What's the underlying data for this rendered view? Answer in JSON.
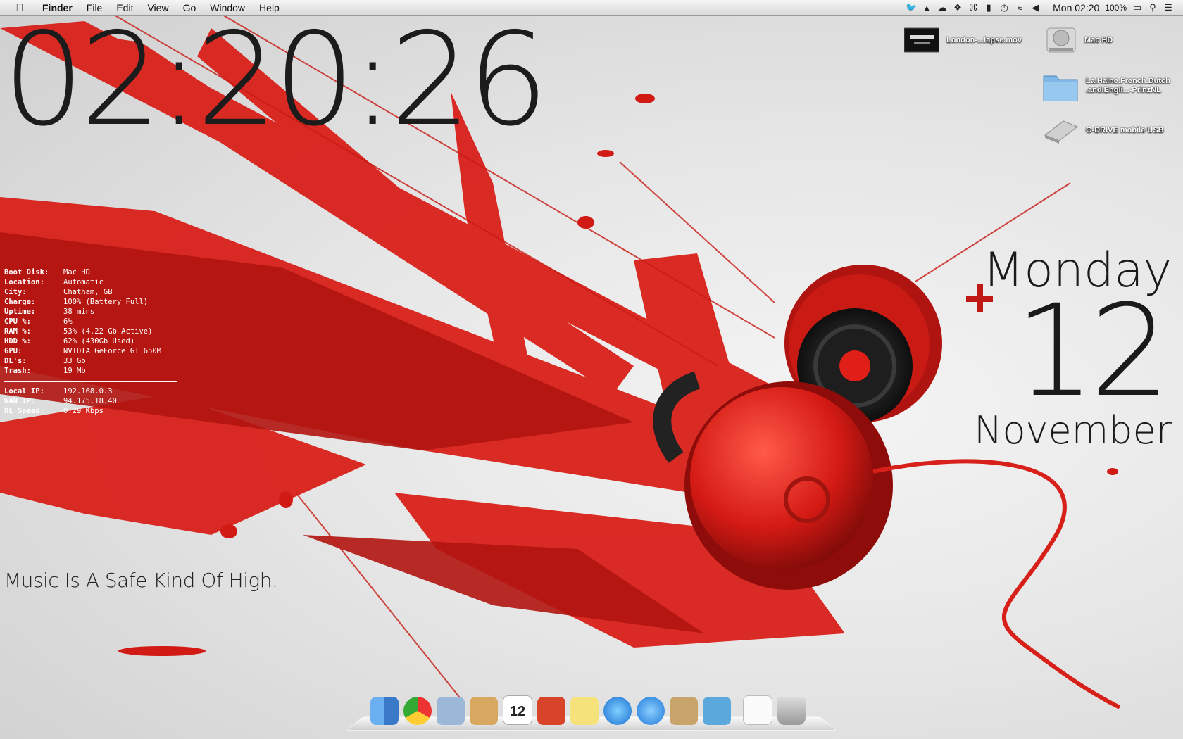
{
  "menubar": {
    "app": "Finder",
    "items": [
      "File",
      "Edit",
      "View",
      "Go",
      "Window",
      "Help"
    ],
    "status_icons": [
      "twitter-icon",
      "google-drive-icon",
      "cloud-icon",
      "dropbox-icon",
      "rss-icon",
      "battery-bars-icon",
      "time-machine-icon",
      "wifi-icon",
      "volume-icon"
    ],
    "clock": "Mon 02:20",
    "battery": "100%"
  },
  "clock_widget": {
    "time": "02:20:26"
  },
  "stats": {
    "rows": [
      {
        "k": "Boot Disk:",
        "v": "Mac HD"
      },
      {
        "k": "Location:",
        "v": "Automatic"
      },
      {
        "k": "City:",
        "v": "Chatham, GB"
      },
      {
        "k": "Charge:",
        "v": "100% (Battery Full)"
      },
      {
        "k": "Uptime:",
        "v": "38 mins"
      },
      {
        "k": "CPU %:",
        "v": "6%"
      },
      {
        "k": "RAM %:",
        "v": "53% (4.22 Gb Active)"
      },
      {
        "k": "HDD %:",
        "v": "62% (430Gb Used)"
      },
      {
        "k": "GPU:",
        "v": "NVIDIA GeForce GT 650M"
      },
      {
        "k": "DL's:",
        "v": "33 Gb"
      },
      {
        "k": "Trash:",
        "v": "19 Mb"
      }
    ],
    "net_rows": [
      {
        "k": "Local IP:",
        "v": "192.168.0.3"
      },
      {
        "k": "WAN IP:",
        "v": "94.175.18.40"
      },
      {
        "k": "DL Speed:",
        "v": "0.29 Kbps"
      }
    ]
  },
  "quote": "Music Is A Safe Kind Of High.",
  "date_widget": {
    "day": "Monday",
    "date": "12",
    "month": "November"
  },
  "desktop": {
    "icons": [
      {
        "name": "movie-file-icon",
        "label": "London-...lapse.mov"
      },
      {
        "name": "hard-drive-icon",
        "label": "Mac HD"
      },
      {
        "name": "folder-icon",
        "label": "La.Haine.French.Dutch .and.Engli...-PrinzNL"
      },
      {
        "name": "external-drive-icon",
        "label": "G-DRIVE mobile USB"
      }
    ]
  },
  "dock": {
    "apps": [
      "finder-icon",
      "chrome-icon",
      "mail-bird-icon",
      "address-book-icon",
      "calendar-icon",
      "wunderlist-icon",
      "stickies-icon",
      "itunes-icon",
      "app-store-icon",
      "recycle-box-icon",
      "twitter-icon",
      "torrent-file-icon",
      "trash-icon"
    ],
    "calendar_date": "12"
  },
  "colors": {
    "accent_red": "#d81e1e",
    "menubar": "#e8e8e8"
  }
}
